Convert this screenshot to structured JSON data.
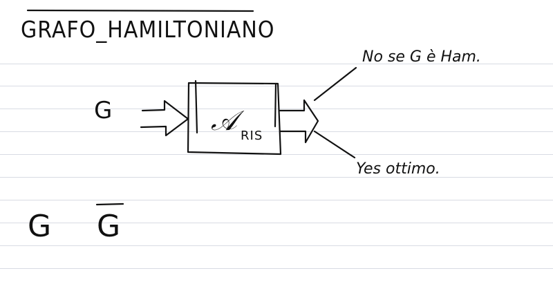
{
  "title": "GRAFO_HAMILTONIANO",
  "input_label": "G",
  "algorithm": {
    "symbol": "𝒜",
    "subscript": "RIS"
  },
  "outputs": {
    "no": "No se G è Ham.",
    "yes": "Yes ottimo."
  },
  "bottom": {
    "graph": "G",
    "complement": "G"
  },
  "colors": {
    "ink": "#111111",
    "rule": "#d8dbe3"
  }
}
